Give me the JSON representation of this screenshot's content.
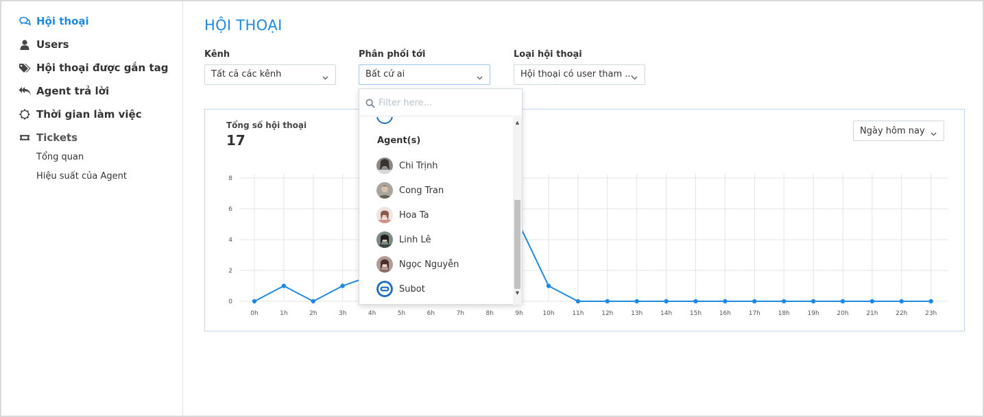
{
  "sidebar": {
    "items": [
      {
        "label": "Hội thoại",
        "icon": "chat-bubbles-icon"
      },
      {
        "label": "Users",
        "icon": "user-icon"
      },
      {
        "label": "Hội thoại được gắn tag",
        "icon": "tags-icon"
      },
      {
        "label": "Agent trả lời",
        "icon": "reply-all-icon"
      },
      {
        "label": "Thời gian làm việc",
        "icon": "gear-icon"
      },
      {
        "label": "Tickets",
        "icon": "ticket-icon"
      }
    ],
    "sub_items": [
      {
        "label": "Tổng quan"
      },
      {
        "label": "Hiệu suất của Agent"
      }
    ]
  },
  "main": {
    "title": "HỘI THOẠI",
    "filters": [
      {
        "label": "Kênh",
        "value": "Tất cả các kênh"
      },
      {
        "label": "Phân phối tới",
        "value": "Bất cứ ai"
      },
      {
        "label": "Loại hội thoại",
        "value": "Hội thoại có user tham ..."
      }
    ]
  },
  "dropdown": {
    "filter_placeholder": "Filter here...",
    "group_label": "Agent(s)",
    "items": [
      {
        "label": "Chi Trịnh"
      },
      {
        "label": "Cong Tran"
      },
      {
        "label": "Hoa Ta"
      },
      {
        "label": "Linh Lê"
      },
      {
        "label": "Ngọc Nguyễn"
      },
      {
        "label": "Subot"
      }
    ]
  },
  "card": {
    "label": "Tổng số hội thoại",
    "total": "17",
    "date_range": "Ngày hôm nay"
  },
  "colors": {
    "accent": "#1e88e5",
    "line": "#1e88e5",
    "grid": "#e3e3e3"
  },
  "chart_data": {
    "type": "line",
    "x": [
      "0h",
      "1h",
      "2h",
      "3h",
      "4h",
      "5h",
      "6h",
      "7h",
      "8h",
      "9h",
      "10h",
      "11h",
      "12h",
      "13h",
      "14h",
      "15h",
      "16h",
      "17h",
      "18h",
      "19h",
      "20h",
      "21h",
      "22h",
      "23h"
    ],
    "series": [
      {
        "values": [
          0,
          1,
          0,
          1,
          null,
          null,
          null,
          null,
          null,
          5,
          1,
          0,
          0,
          0,
          0,
          0,
          0,
          0,
          0,
          0,
          0,
          0,
          0,
          0
        ]
      }
    ],
    "yticks": [
      "0",
      "2",
      "4",
      "6",
      "8"
    ],
    "ylim": [
      0,
      8
    ],
    "grid": true
  }
}
